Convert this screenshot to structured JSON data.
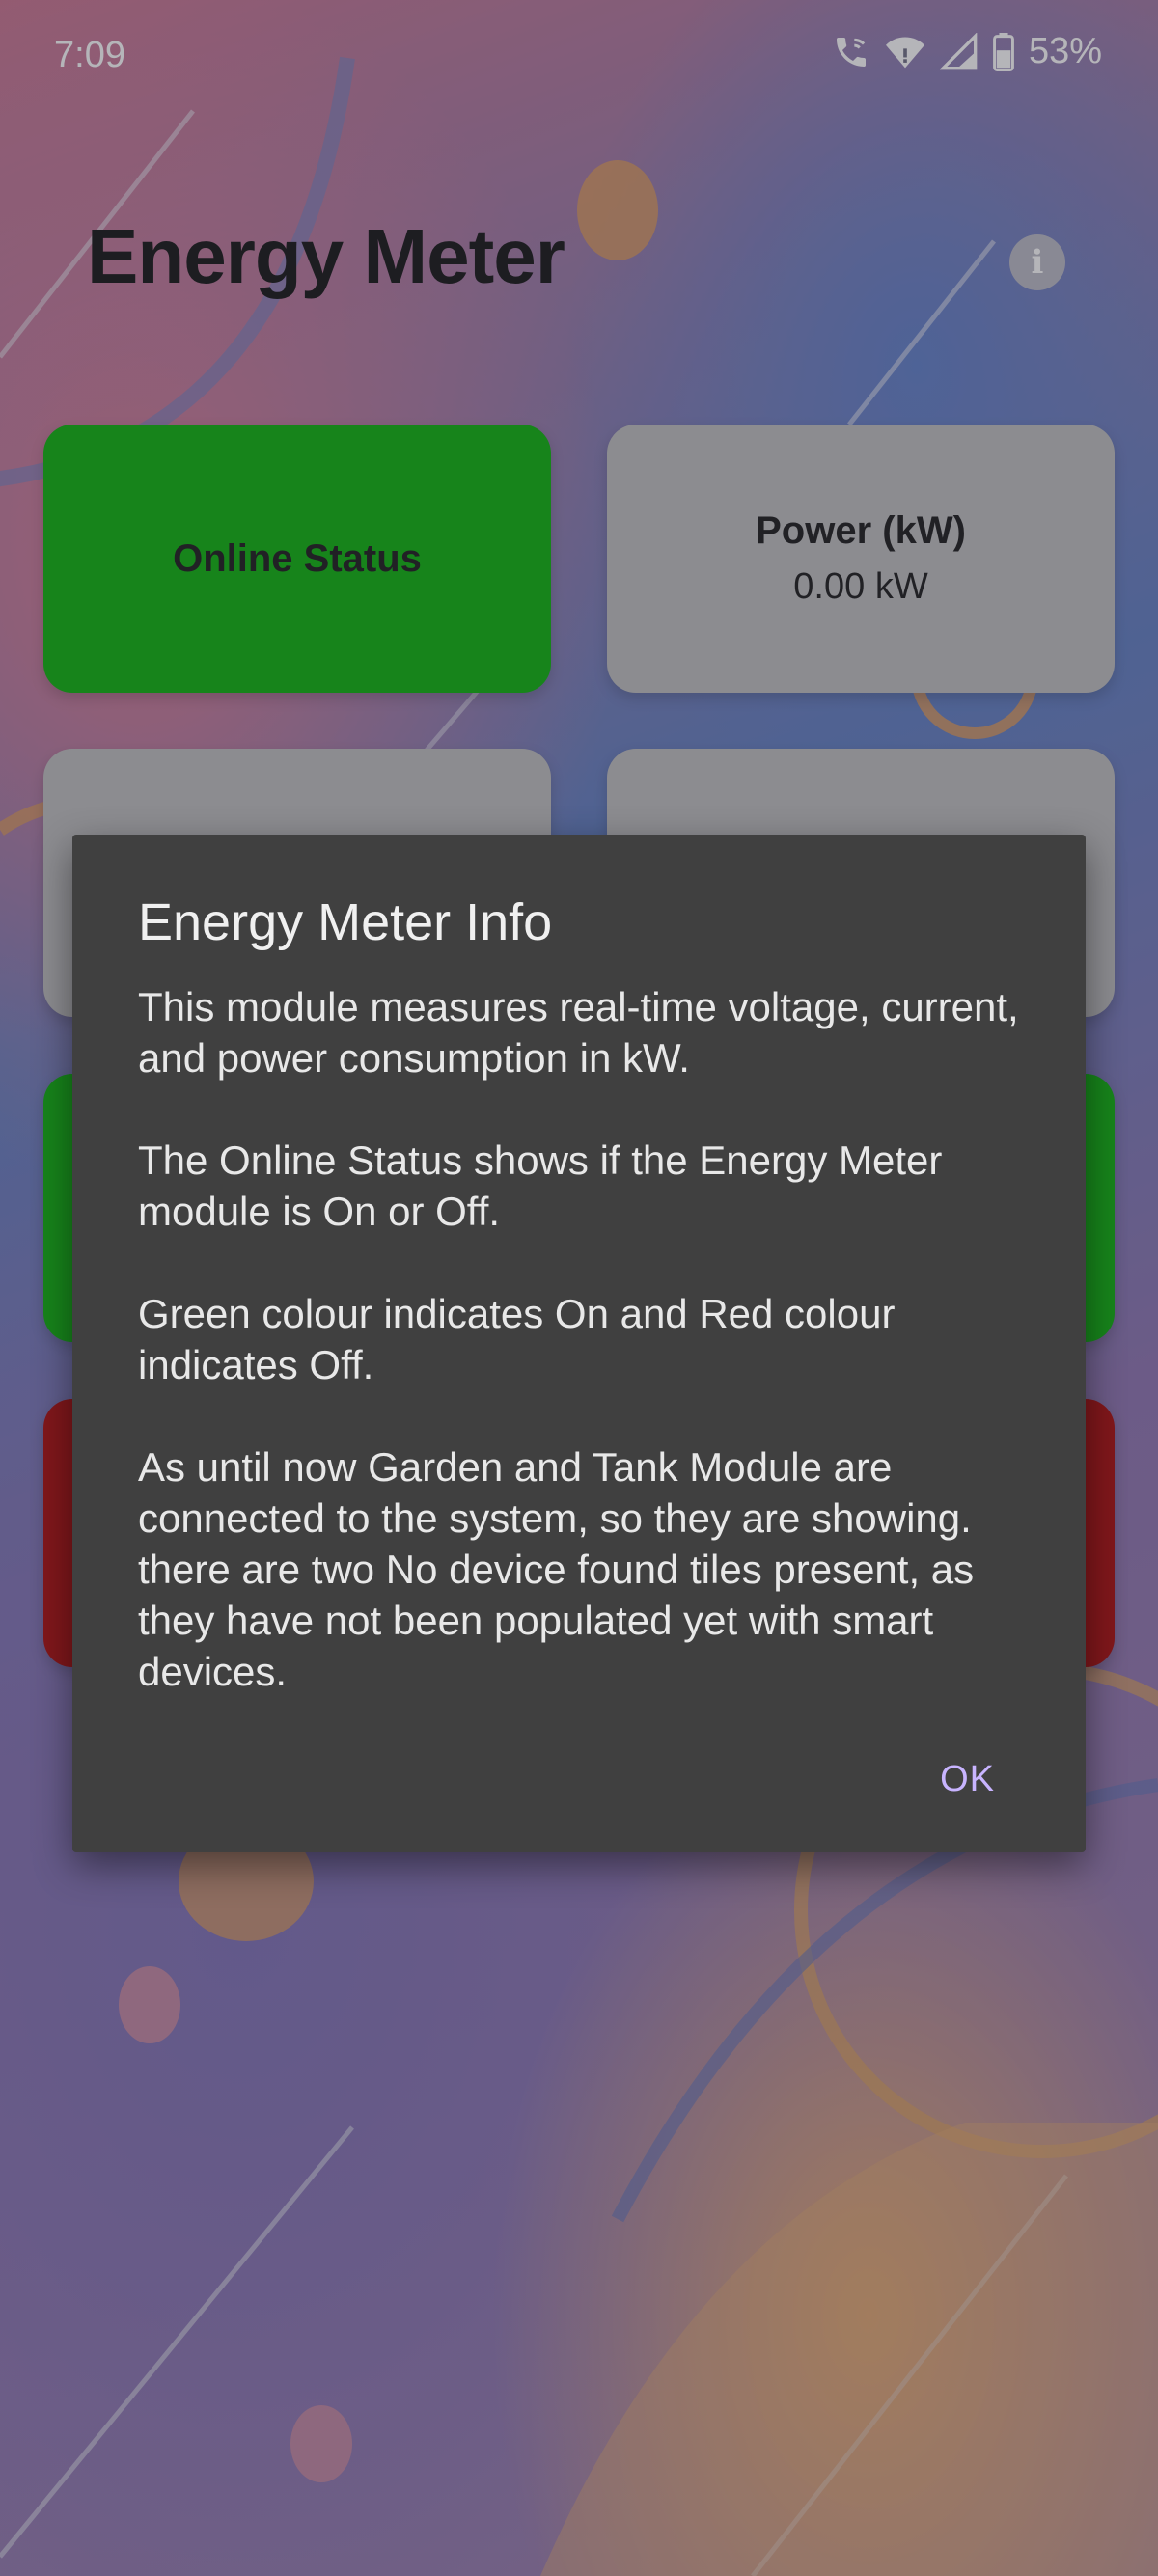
{
  "status_bar": {
    "time": "7:09",
    "battery_percent": "53%",
    "icons": [
      "wifi-calling-icon",
      "wifi-icon",
      "cellular-signal-icon",
      "battery-icon"
    ]
  },
  "header": {
    "title": "Energy Meter",
    "info_icon": "info-icon"
  },
  "tiles": {
    "online_status": {
      "title": "Online Status",
      "color": "#00b000"
    },
    "power": {
      "title": "Power (kW)",
      "value": "0.00 kW",
      "color": "#bdbdbd"
    }
  },
  "dialog": {
    "title": "Energy Meter Info",
    "paragraphs": [
      "This module measures real-time voltage, current, and power consumption in kW.",
      "The Online Status shows if the Energy Meter module is On or Off.",
      "Green colour indicates On and Red colour indicates Off.",
      "As until now Garden and Tank Module are connected to the system, so they are showing. there are two No device found tiles present, as they have not been populated yet with smart devices."
    ],
    "ok_label": "OK"
  },
  "colors": {
    "green_tile": "#00b000",
    "grey_tile": "#bdbdbd",
    "red_tile": "#aa0000",
    "dialog_bg": "#404040",
    "accent": "#c8b4ff"
  }
}
